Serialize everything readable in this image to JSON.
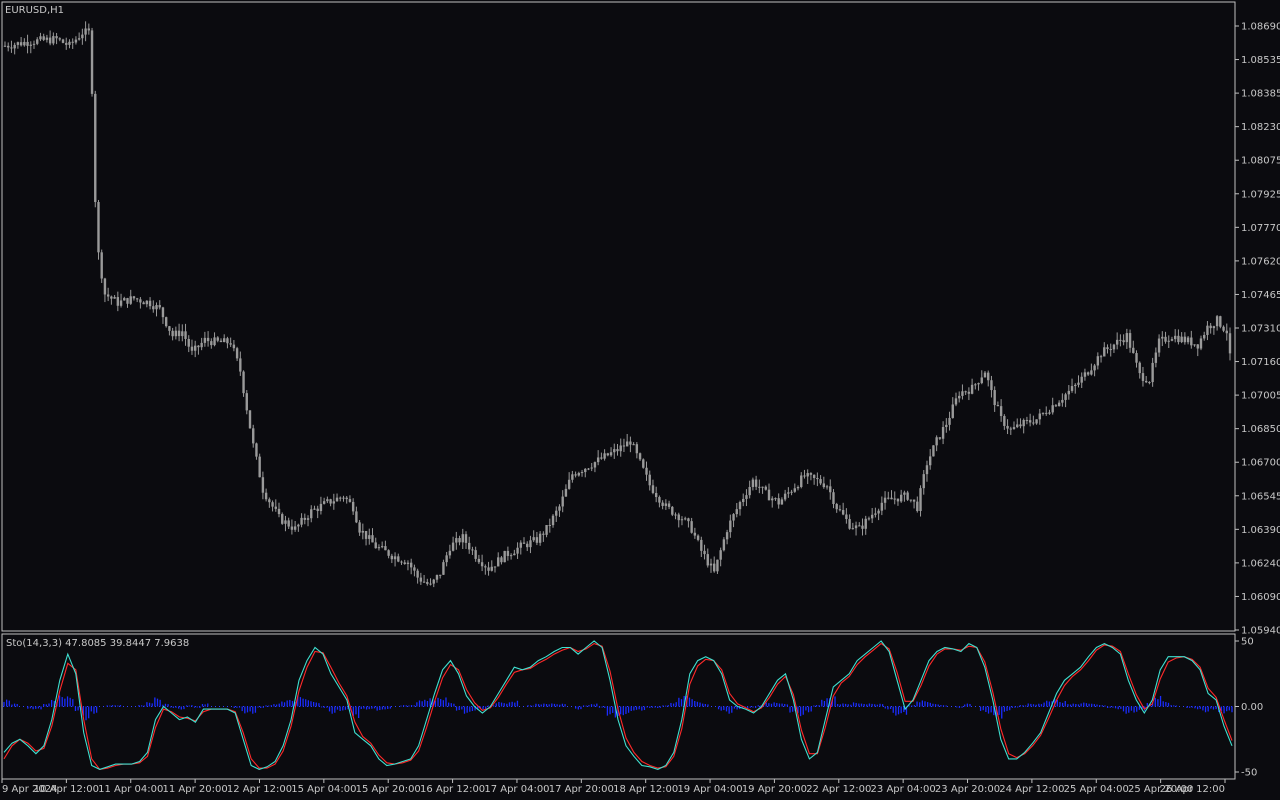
{
  "colors": {
    "background": "#0b0b0f",
    "frame": "#c0c0c0",
    "candle": "#9a9a9a",
    "stoch_main": "#ff2a2a",
    "stoch_signal": "#3fe0d0",
    "histogram": "#1a2cff",
    "text": "#c8c8c8"
  },
  "chart_data": [
    {
      "type": "candlestick",
      "title": "EURUSD,H1",
      "price_axis": {
        "ticks": [
          "1.08690",
          "1.08535",
          "1.08385",
          "1.08230",
          "1.08075",
          "1.07925",
          "1.07770",
          "1.07620",
          "1.07465",
          "1.07310",
          "1.07160",
          "1.07005",
          "1.06850",
          "1.06700",
          "1.06545",
          "1.06390",
          "1.06240",
          "1.06090",
          "1.05940"
        ],
        "ylim": [
          1.0594,
          1.0869
        ]
      },
      "time_axis": {
        "ticks": [
          "9 Apr 2024",
          "10 Apr 12:00",
          "11 Apr 04:00",
          "11 Apr 20:00",
          "12 Apr 12:00",
          "15 Apr 04:00",
          "15 Apr 20:00",
          "16 Apr 12:00",
          "17 Apr 04:00",
          "17 Apr 20:00",
          "18 Apr 12:00",
          "19 Apr 04:00",
          "19 Apr 20:00",
          "22 Apr 12:00",
          "23 Apr 04:00",
          "23 Apr 20:00",
          "24 Apr 12:00",
          "25 Apr 04:00",
          "25 Apr 20:00",
          "26 Apr 12:00"
        ]
      },
      "close_path": [
        [
          0,
          1.086
        ],
        [
          8,
          1.0862
        ],
        [
          16,
          1.0863
        ],
        [
          20,
          1.086
        ],
        [
          24,
          1.0866
        ],
        [
          26,
          1.0866
        ],
        [
          27,
          1.084
        ],
        [
          28,
          1.079
        ],
        [
          29,
          1.0765
        ],
        [
          31,
          1.0747
        ],
        [
          35,
          1.0743
        ],
        [
          40,
          1.0745
        ],
        [
          45,
          1.0743
        ],
        [
          48,
          1.074
        ],
        [
          52,
          1.0728
        ],
        [
          55,
          1.073
        ],
        [
          58,
          1.072
        ],
        [
          62,
          1.0726
        ],
        [
          66,
          1.0725
        ],
        [
          70,
          1.0725
        ],
        [
          73,
          1.0712
        ],
        [
          77,
          1.0678
        ],
        [
          80,
          1.0658
        ],
        [
          85,
          1.0645
        ],
        [
          90,
          1.064
        ],
        [
          95,
          1.0648
        ],
        [
          100,
          1.0652
        ],
        [
          105,
          1.0655
        ],
        [
          108,
          1.065
        ],
        [
          110,
          1.064
        ],
        [
          115,
          1.0632
        ],
        [
          120,
          1.0628
        ],
        [
          125,
          1.0625
        ],
        [
          128,
          1.0618
        ],
        [
          132,
          1.0614
        ],
        [
          135,
          1.062
        ],
        [
          138,
          1.0632
        ],
        [
          142,
          1.0636
        ],
        [
          146,
          1.0628
        ],
        [
          150,
          1.0622
        ],
        [
          155,
          1.0628
        ],
        [
          160,
          1.0632
        ],
        [
          165,
          1.0635
        ],
        [
          168,
          1.064
        ],
        [
          172,
          1.065
        ],
        [
          176,
          1.0665
        ],
        [
          180,
          1.0668
        ],
        [
          185,
          1.0672
        ],
        [
          190,
          1.0676
        ],
        [
          194,
          1.068
        ],
        [
          197,
          1.067
        ],
        [
          200,
          1.066
        ],
        [
          205,
          1.065
        ],
        [
          210,
          1.0645
        ],
        [
          213,
          1.064
        ],
        [
          216,
          1.063
        ],
        [
          220,
          1.062
        ],
        [
          224,
          1.064
        ],
        [
          228,
          1.0652
        ],
        [
          232,
          1.0662
        ],
        [
          236,
          1.0656
        ],
        [
          240,
          1.0652
        ],
        [
          244,
          1.0658
        ],
        [
          248,
          1.0664
        ],
        [
          252,
          1.0662
        ],
        [
          255,
          1.066
        ],
        [
          258,
          1.065
        ],
        [
          262,
          1.0642
        ],
        [
          265,
          1.064
        ],
        [
          268,
          1.0645
        ],
        [
          272,
          1.0652
        ],
        [
          276,
          1.0654
        ],
        [
          280,
          1.0655
        ],
        [
          283,
          1.065
        ],
        [
          286,
          1.067
        ],
        [
          289,
          1.068
        ],
        [
          292,
          1.0688
        ],
        [
          296,
          1.0702
        ],
        [
          300,
          1.0704
        ],
        [
          304,
          1.0712
        ],
        [
          306,
          1.0702
        ],
        [
          309,
          1.069
        ],
        [
          312,
          1.0685
        ],
        [
          316,
          1.0688
        ],
        [
          320,
          1.069
        ],
        [
          324,
          1.0695
        ],
        [
          328,
          1.07
        ],
        [
          332,
          1.0705
        ],
        [
          336,
          1.0712
        ],
        [
          340,
          1.072
        ],
        [
          344,
          1.0724
        ],
        [
          348,
          1.0728
        ],
        [
          352,
          1.071
        ],
        [
          355,
          1.0708
        ],
        [
          358,
          1.0725
        ],
        [
          362,
          1.0728
        ],
        [
          366,
          1.0726
        ],
        [
          370,
          1.0724
        ],
        [
          373,
          1.0732
        ],
        [
          376,
          1.0735
        ],
        [
          379,
          1.073
        ],
        [
          380,
          1.0718
        ]
      ]
    },
    {
      "type": "line",
      "title": "Sto(14,3,3) 47.8085 39.8447 7.9638",
      "indicator": "Sto(14,3,3)",
      "values_shown": [
        "47.8085",
        "39.8447",
        "7.9638"
      ],
      "y_ticks": [
        "50",
        "0.00",
        "-50"
      ],
      "ylim": [
        -50,
        50
      ],
      "series": [
        {
          "values": [
            -35,
            -28,
            -25,
            -30,
            -36,
            -30,
            -10,
            20,
            40,
            25,
            -20,
            -45,
            -48,
            -46,
            -44,
            -44,
            -44,
            -42,
            -35,
            -10,
            0,
            -5,
            -10,
            -8,
            -12,
            -2,
            -2,
            -2,
            -2,
            -5,
            -25,
            -45,
            -48,
            -46,
            -42,
            -30,
            -10,
            20,
            35,
            45,
            40,
            25,
            15,
            5,
            -20,
            -25,
            -30,
            -40,
            -45,
            -44,
            -42,
            -40,
            -30,
            -10,
            10,
            28,
            35,
            25,
            8,
            0,
            -5,
            0,
            10,
            20,
            30,
            28,
            30,
            35,
            38,
            42,
            45,
            45,
            40,
            45,
            50,
            45,
            20,
            -10,
            -30,
            -38,
            -45,
            -46,
            -48,
            -45,
            -35,
            -10,
            25,
            35,
            38,
            35,
            25,
            5,
            0,
            -2,
            -5,
            0,
            10,
            20,
            25,
            5,
            -25,
            -40,
            -35,
            -10,
            15,
            20,
            25,
            35,
            40,
            45,
            50,
            42,
            20,
            -2,
            5,
            20,
            35,
            42,
            45,
            44,
            42,
            48,
            45,
            30,
            5,
            -25,
            -40,
            -40,
            -35,
            -28,
            -20,
            -5,
            10,
            20,
            25,
            30,
            38,
            45,
            48,
            45,
            40,
            20,
            5,
            -5,
            5,
            28,
            38,
            38,
            38,
            35,
            28,
            10,
            5,
            -15,
            -30
          ]
        },
        {
          "values": [
            -40,
            -30,
            -25,
            -28,
            -34,
            -32,
            -15,
            12,
            33,
            28,
            -10,
            -40,
            -48,
            -47,
            -45,
            -44,
            -44,
            -43,
            -38,
            -16,
            -2,
            -4,
            -8,
            -9,
            -11,
            -4,
            -2,
            -2,
            -2,
            -4,
            -20,
            -40,
            -47,
            -47,
            -44,
            -34,
            -15,
            12,
            30,
            42,
            41,
            30,
            18,
            8,
            -12,
            -23,
            -28,
            -37,
            -43,
            -44,
            -43,
            -41,
            -34,
            -16,
            4,
            22,
            32,
            28,
            13,
            3,
            -3,
            -1,
            7,
            17,
            26,
            28,
            29,
            33,
            36,
            40,
            43,
            45,
            42,
            44,
            48,
            46,
            27,
            -2,
            -24,
            -35,
            -42,
            -45,
            -47,
            -46,
            -38,
            -17,
            17,
            31,
            36,
            35,
            28,
            10,
            2,
            -1,
            -4,
            -1,
            7,
            17,
            23,
            9,
            -18,
            -36,
            -36,
            -16,
            8,
            18,
            23,
            32,
            38,
            43,
            48,
            44,
            26,
            4,
            4,
            16,
            31,
            40,
            44,
            44,
            43,
            46,
            45,
            34,
            11,
            -17,
            -36,
            -39,
            -36,
            -30,
            -22,
            -9,
            5,
            16,
            23,
            28,
            35,
            43,
            47,
            46,
            42,
            25,
            9,
            -2,
            2,
            21,
            34,
            37,
            38,
            36,
            30,
            14,
            7,
            -10,
            -26
          ]
        },
        {
          "values": [
            5,
            2,
            0,
            -2,
            -2,
            2,
            5,
            8,
            7,
            -3,
            -10,
            -5,
            0,
            1,
            1,
            0,
            0,
            1,
            3,
            6,
            2,
            -1,
            -2,
            1,
            -1,
            2,
            0,
            0,
            0,
            -1,
            -5,
            -5,
            -1,
            1,
            2,
            4,
            5,
            8,
            5,
            3,
            -1,
            -5,
            -3,
            -3,
            -8,
            -2,
            -2,
            -3,
            -2,
            0,
            1,
            1,
            4,
            6,
            6,
            6,
            3,
            -3,
            -5,
            -3,
            -2,
            1,
            3,
            3,
            4,
            0,
            1,
            2,
            2,
            2,
            2,
            0,
            -2,
            1,
            2,
            -1,
            -7,
            -8,
            -6,
            -3,
            -3,
            -1,
            -1,
            1,
            3,
            7,
            8,
            4,
            2,
            0,
            -3,
            -5,
            -2,
            -1,
            -1,
            1,
            3,
            3,
            2,
            -4,
            -7,
            -4,
            1,
            6,
            7,
            2,
            2,
            3,
            2,
            2,
            2,
            -2,
            -6,
            -6,
            1,
            4,
            4,
            2,
            1,
            0,
            -1,
            2,
            0,
            -4,
            -6,
            -8,
            -4,
            -1,
            1,
            2,
            2,
            4,
            5,
            4,
            2,
            2,
            3,
            2,
            1,
            -1,
            -2,
            -5,
            -4,
            -3,
            3,
            7,
            4,
            1,
            0,
            -1,
            -2,
            -4,
            -2,
            -5,
            -4
          ]
        }
      ]
    }
  ]
}
